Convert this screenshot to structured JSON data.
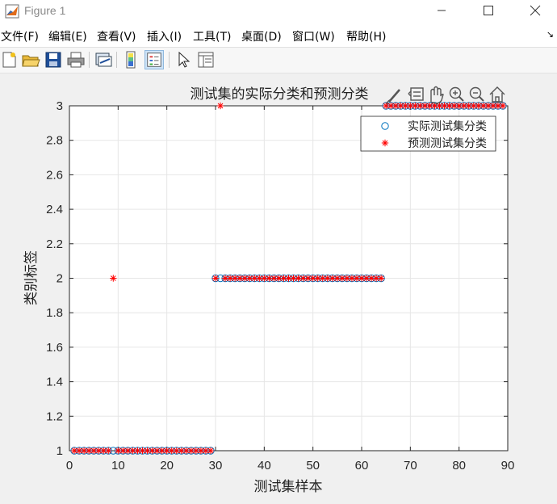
{
  "window": {
    "title": "Figure 1"
  },
  "menu": [
    "文件(F)",
    "编辑(E)",
    "查看(V)",
    "插入(I)",
    "工具(T)",
    "桌面(D)",
    "窗口(W)",
    "帮助(H)"
  ],
  "toolbar": {
    "icons": [
      "new-figure-icon",
      "open-file-icon",
      "save-icon",
      "print-icon",
      "link-plot-icon",
      "colorbar-icon",
      "legend-icon",
      "edit-plot-icon",
      "property-inspector-icon"
    ]
  },
  "axes_toolbar": {
    "icons": [
      "brush-icon",
      "data-tips-icon",
      "pan-icon",
      "zoom-in-icon",
      "zoom-out-icon",
      "home-icon"
    ]
  },
  "colors": {
    "actual": "#0072bd",
    "predicted": "#ff0000",
    "grid": "#e6e6e6"
  },
  "chart_data": {
    "type": "scatter",
    "title": "测试集的实际分类和预测分类",
    "xlabel": "测试集样本",
    "ylabel": "类别标签",
    "xlim": [
      0,
      90
    ],
    "ylim": [
      1,
      3
    ],
    "xticks": [
      0,
      10,
      20,
      30,
      40,
      50,
      60,
      70,
      80,
      90
    ],
    "yticks": [
      1,
      1.2,
      1.4,
      1.6,
      1.8,
      2,
      2.2,
      2.4,
      2.6,
      2.8,
      3
    ],
    "xtick_labels": [
      "0",
      "10",
      "20",
      "30",
      "40",
      "50",
      "60",
      "70",
      "80",
      "90"
    ],
    "ytick_labels": [
      "1",
      "1.2",
      "1.4",
      "1.6",
      "1.8",
      "2",
      "2.2",
      "2.4",
      "2.6",
      "2.8",
      "3"
    ],
    "grid": true,
    "legend_position": "top-right",
    "series": [
      {
        "name": "实际测试集分类",
        "marker": "circle",
        "color": "#0072bd",
        "segments": [
          {
            "x_from": 1,
            "x_to": 29,
            "y": 1
          },
          {
            "x_from": 30,
            "x_to": 64,
            "y": 2
          },
          {
            "x_from": 65,
            "x_to": 89,
            "y": 3
          }
        ]
      },
      {
        "name": "预测测试集分类",
        "marker": "asterisk",
        "color": "#ff0000",
        "segments": [
          {
            "x_from": 1,
            "x_to": 8,
            "y": 1
          },
          {
            "x_from": 9,
            "x_to": 9,
            "y": 2
          },
          {
            "x_from": 10,
            "x_to": 29,
            "y": 1
          },
          {
            "x_from": 30,
            "x_to": 30,
            "y": 2
          },
          {
            "x_from": 31,
            "x_to": 31,
            "y": 3
          },
          {
            "x_from": 32,
            "x_to": 64,
            "y": 2
          },
          {
            "x_from": 65,
            "x_to": 89,
            "y": 3
          }
        ]
      }
    ]
  }
}
